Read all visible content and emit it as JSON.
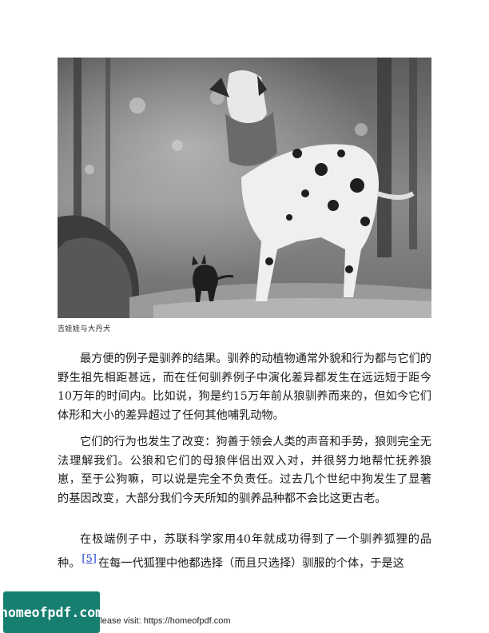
{
  "figure": {
    "caption": "吉娃娃与大丹犬"
  },
  "paragraphs": {
    "p1": "最方便的例子是驯养的结果。驯养的动植物通常外貌和行为都与它们的野生祖先相距甚远，而在任何驯养例子中演化差异都发生在远远短于距今10万年的时间内。比如说，狗是约15万年前从狼驯养而来的，但如今它们体形和大小的差异超过了任何其他哺乳动物。",
    "p2": "它们的行为也发生了改变：狗善于领会人类的声音和手势，狼则完全无法理解我们。公狼和它们的母狼伴侣出双入对，并很努力地帮忙抚养狼崽，至于公狗嘛，可以说是完全不负责任。过去几个世纪中狗发生了显著的基因改变，大部分我们今天所知的驯养品种都不会比这更古老。",
    "p3_before": "在极端例子中，苏联科学家用40年就成功得到了一个驯养狐狸的品种。",
    "p3_ref": "[5]",
    "p3_after": "在每一代狐狸中他都选择（而且只选择）驯服的个体，于是这"
  },
  "footer": {
    "text": "e please visit: https://homeofpdf.com"
  },
  "badge": {
    "label": "homeofpdf.com",
    "color": "#167f70"
  }
}
